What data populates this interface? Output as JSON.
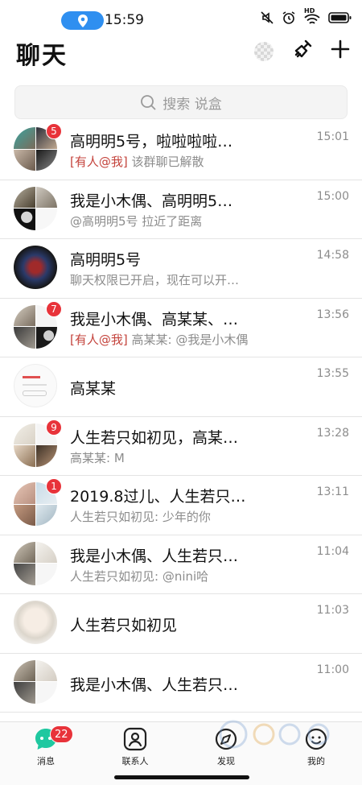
{
  "status_bar": {
    "time": "15:59",
    "location_icon": "location-pin-icon",
    "network_label": "HD",
    "colors": {
      "pill": "#2f8ff0"
    }
  },
  "header": {
    "title": "聊天"
  },
  "search": {
    "placeholder": "搜索 说盒"
  },
  "chats": [
    {
      "name": "高明明5号，啦啦啦啦…",
      "mention": "[有人@我]",
      "preview": "该群聊已解散",
      "time": "15:01",
      "badge": "5"
    },
    {
      "name": "我是小木偶、高明明5…",
      "mention": "",
      "preview": "@高明明5号 拉近了距离",
      "time": "15:00",
      "badge": ""
    },
    {
      "name": "高明明5号",
      "mention": "",
      "preview": "聊天权限已开启，现在可以开…",
      "time": "14:58",
      "badge": ""
    },
    {
      "name": "我是小木偶、高某某、…",
      "mention": "[有人@我]",
      "preview": "高某某: @我是小木偶",
      "time": "13:56",
      "badge": "7"
    },
    {
      "name": "高某某",
      "mention": "",
      "preview": "",
      "time": "13:55",
      "badge": ""
    },
    {
      "name": "人生若只如初见，高某…",
      "mention": "",
      "preview": "高某某: M",
      "time": "13:28",
      "badge": "9"
    },
    {
      "name": "2019.8过儿、人生若只…",
      "mention": "",
      "preview": "人生若只如初见: 少年的你",
      "time": "13:11",
      "badge": "1"
    },
    {
      "name": "我是小木偶、人生若只…",
      "mention": "",
      "preview": "人生若只如初见: @nini哈",
      "time": "11:04",
      "badge": ""
    },
    {
      "name": "人生若只如初见",
      "mention": "",
      "preview": "",
      "time": "11:03",
      "badge": ""
    },
    {
      "name": "我是小木偶、人生若只…",
      "mention": "",
      "preview": "",
      "time": "11:00",
      "badge": ""
    }
  ],
  "bottom_nav": {
    "messages_label": "消息",
    "messages_badge": "22",
    "contacts_label": "联系人",
    "discover_label": "发现",
    "me_label": "我的",
    "active_color": "#1fc8a0"
  }
}
